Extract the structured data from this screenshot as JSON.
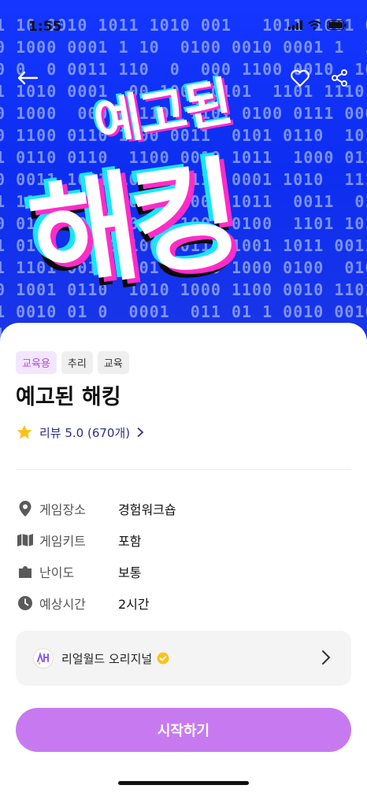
{
  "status_bar": {
    "time": "1:55"
  },
  "hero": {
    "title_line1": "예고된",
    "title_line2": "해킹",
    "back_icon": "back-arrow-icon",
    "favorite_icon": "heart-icon",
    "share_icon": "share-icon"
  },
  "tags": [
    "교육용",
    "추리",
    "교육"
  ],
  "game": {
    "title": "예고된 해킹",
    "review_label": "리뷰 5.0 (670개)"
  },
  "info": [
    {
      "icon": "location-pin-icon",
      "label": "게임장소",
      "value": "경험워크숍"
    },
    {
      "icon": "map-icon",
      "label": "게임키트",
      "value": "포함"
    },
    {
      "icon": "puzzle-icon",
      "label": "난이도",
      "value": "보통"
    },
    {
      "icon": "clock-icon",
      "label": "예상시간",
      "value": "2시간"
    }
  ],
  "creator": {
    "name": "리얼월드 오리지널",
    "verified_icon": "verified-badge-icon"
  },
  "cta": {
    "label": "시작하기"
  },
  "colors": {
    "accent": "#c77af0",
    "tag_purple_text": "#b14de0",
    "hero_blue": "#1436ff",
    "review_text": "#2d2f8a"
  }
}
